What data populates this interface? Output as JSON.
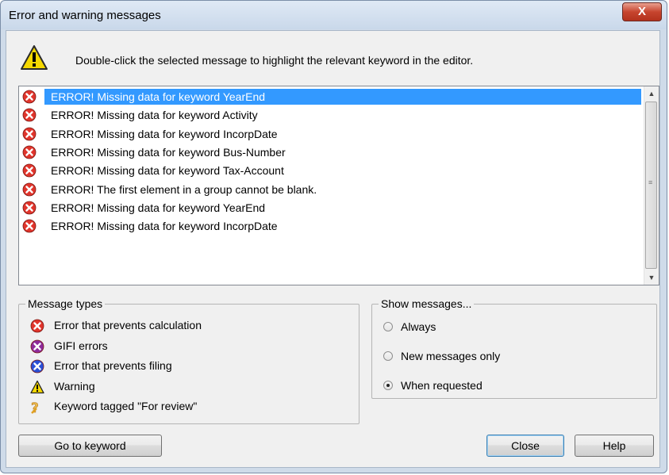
{
  "window": {
    "title": "Error and warning messages",
    "close_glyph": "X"
  },
  "instruction": "Double-click the selected message to highlight the relevant keyword in the editor.",
  "messages": [
    {
      "icon": "error-icon",
      "text": "ERROR! Missing data for keyword YearEnd",
      "selected": true
    },
    {
      "icon": "error-icon",
      "text": "ERROR! Missing data for keyword Activity"
    },
    {
      "icon": "error-icon",
      "text": "ERROR! Missing data for keyword IncorpDate"
    },
    {
      "icon": "error-icon",
      "text": "ERROR! Missing data for keyword Bus-Number"
    },
    {
      "icon": "error-icon",
      "text": "ERROR! Missing data for keyword Tax-Account"
    },
    {
      "icon": "error-icon",
      "text": "ERROR! The first element in a group cannot be blank."
    },
    {
      "icon": "error-icon",
      "text": "ERROR! Missing data for keyword YearEnd"
    },
    {
      "icon": "error-icon",
      "text": "ERROR! Missing data for keyword IncorpDate"
    }
  ],
  "message_types": {
    "label": "Message types",
    "items": [
      {
        "icon": "error-icon",
        "text": "Error that prevents calculation"
      },
      {
        "icon": "gifi-error-icon",
        "text": "GIFI errors"
      },
      {
        "icon": "filing-error-icon",
        "text": "Error that prevents filing"
      },
      {
        "icon": "warning-icon",
        "text": "Warning"
      },
      {
        "icon": "review-icon",
        "text": "Keyword tagged \"For review\""
      }
    ]
  },
  "show_messages": {
    "label": "Show messages...",
    "options": [
      {
        "text": "Always",
        "checked": false
      },
      {
        "text": "New messages only",
        "checked": false
      },
      {
        "text": "When requested",
        "checked": true
      }
    ]
  },
  "buttons": {
    "goto": "Go to keyword",
    "close": "Close",
    "help": "Help"
  },
  "colors": {
    "error": "#e0342b",
    "gifi": "#8e2a9a",
    "filing": "#2a4fd6",
    "warning": "#f5d800",
    "selection": "#3399ff"
  }
}
